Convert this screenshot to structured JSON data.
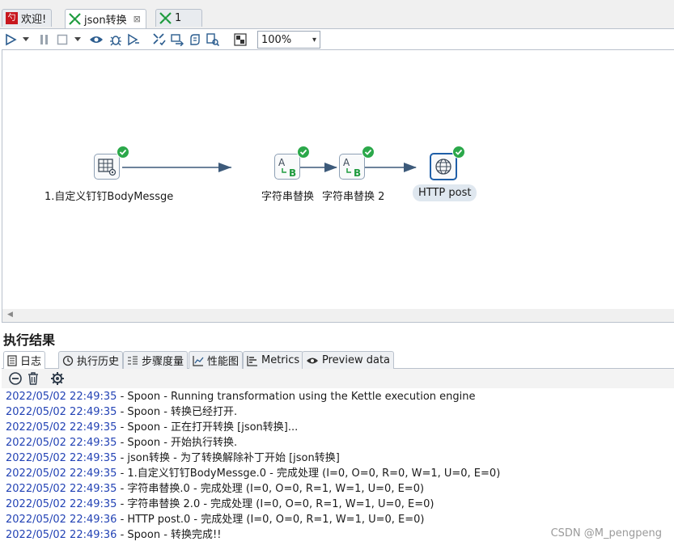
{
  "tabs": [
    {
      "label": "欢迎!",
      "icon": "spoon-icon"
    },
    {
      "label": "json转换",
      "icon": "transformation-icon",
      "close": "⊠"
    },
    {
      "label": "1",
      "icon": "transformation-icon"
    }
  ],
  "toolbar": {
    "zoom": "100%",
    "buttons": [
      "run",
      "run-options",
      "pause",
      "stop",
      "stop-options",
      "preview",
      "debug",
      "replay",
      "verify",
      "impact",
      "sql",
      "explore-db",
      "show-results"
    ]
  },
  "steps": [
    {
      "label": "1.自定义钉钉BodyMessge",
      "icon": "table-gear-icon",
      "status": "ok"
    },
    {
      "label": "字符串替换",
      "icon": "replace-string-icon",
      "status": "ok"
    },
    {
      "label": "字符串替换 2",
      "icon": "replace-string-icon",
      "status": "ok"
    },
    {
      "label": "HTTP post",
      "icon": "globe-icon",
      "status": "ok",
      "selected": true
    }
  ],
  "results": {
    "title": "执行结果",
    "tabs": [
      {
        "label": "日志",
        "icon": "log-icon"
      },
      {
        "label": "执行历史",
        "icon": "history-icon"
      },
      {
        "label": "步骤度量",
        "icon": "step-metrics-icon"
      },
      {
        "label": "性能图",
        "icon": "perf-chart-icon"
      },
      {
        "label": "Metrics",
        "icon": "metrics-icon"
      },
      {
        "label": "Preview data",
        "icon": "eye-icon"
      }
    ],
    "log": [
      {
        "ts": "2022/05/02 22:49:35",
        "msg": " - Spoon - Running transformation using the Kettle execution engine"
      },
      {
        "ts": "2022/05/02 22:49:35",
        "msg": " - Spoon - 转换已经打开."
      },
      {
        "ts": "2022/05/02 22:49:35",
        "msg": " - Spoon - 正在打开转换 [json转换]..."
      },
      {
        "ts": "2022/05/02 22:49:35",
        "msg": " - Spoon - 开始执行转换."
      },
      {
        "ts": "2022/05/02 22:49:35",
        "msg": " - json转换 - 为了转换解除补丁开始  [json转换]"
      },
      {
        "ts": "2022/05/02 22:49:35",
        "msg": " - 1.自定义钉钉BodyMessge.0 - 完成处理 (I=0, O=0, R=0, W=1, U=0, E=0)"
      },
      {
        "ts": "2022/05/02 22:49:35",
        "msg": " - 字符串替换.0 - 完成处理 (I=0, O=0, R=1, W=1, U=0, E=0)"
      },
      {
        "ts": "2022/05/02 22:49:35",
        "msg": " - 字符串替换 2.0 - 完成处理 (I=0, O=0, R=1, W=1, U=0, E=0)"
      },
      {
        "ts": "2022/05/02 22:49:36",
        "msg": " - HTTP post.0 - 完成处理 (I=0, O=0, R=1, W=1, U=0, E=0)"
      },
      {
        "ts": "2022/05/02 22:49:36",
        "msg": " - Spoon - 转换完成!!"
      }
    ]
  },
  "watermark": "CSDN @M_pengpeng",
  "colors": {
    "accent": "#1f5fa8",
    "ok": "#2ba84a",
    "timestamp": "#2343b5",
    "hop": "#3d5a7a"
  }
}
